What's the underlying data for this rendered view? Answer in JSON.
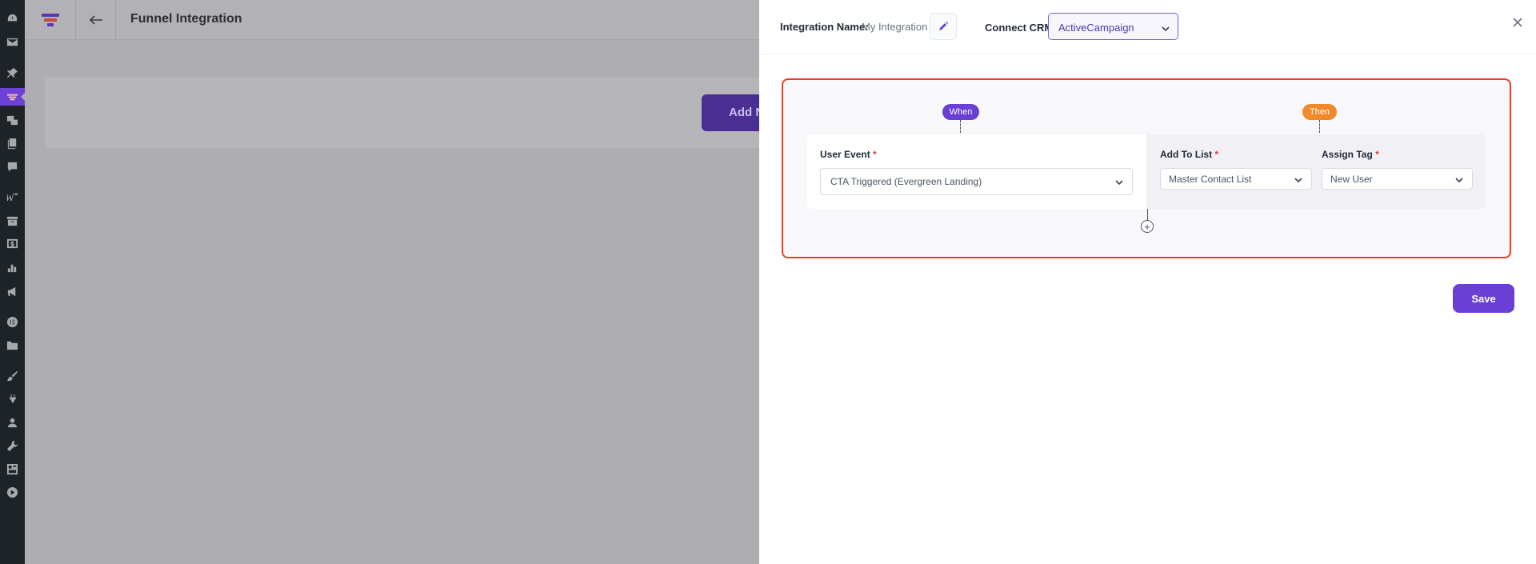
{
  "app": {
    "title": "Funnel Integration",
    "add_button_label": "Add N"
  },
  "drawer": {
    "integration_name_label": "Integration Name:",
    "integration_name_value": "My Integration",
    "crm_label": "Connect CRM",
    "crm_selected": "ActiveCampaign",
    "flow": {
      "when_badge": "When",
      "then_badge": "Then",
      "user_event_label": "User Event",
      "user_event_value": "CTA Triggered (Evergreen Landing)",
      "add_to_list_label": "Add To List",
      "add_to_list_value": "Master Contact List",
      "assign_tag_label": "Assign Tag",
      "assign_tag_value": "New User",
      "required_mark": "*",
      "add_step_symbol": "+"
    },
    "save_label": "Save"
  },
  "colors": {
    "accent": "#6a3fd4",
    "then_badge": "#f08a2b",
    "highlight_border": "#ef3b27",
    "wp_sidebar": "#1e2327"
  },
  "icons": {
    "sidebar": [
      "dashboard-icon",
      "mail-icon",
      "pin-icon",
      "funnel-icon",
      "media-icon",
      "pages-icon",
      "comments-icon",
      "woo-icon",
      "archive-icon",
      "dollar-icon",
      "analytics-icon",
      "megaphone-icon",
      "elementor-icon",
      "folder-icon",
      "brush-icon",
      "plugin-icon",
      "user-icon",
      "wrench-icon",
      "layout-icon",
      "play-icon"
    ]
  }
}
